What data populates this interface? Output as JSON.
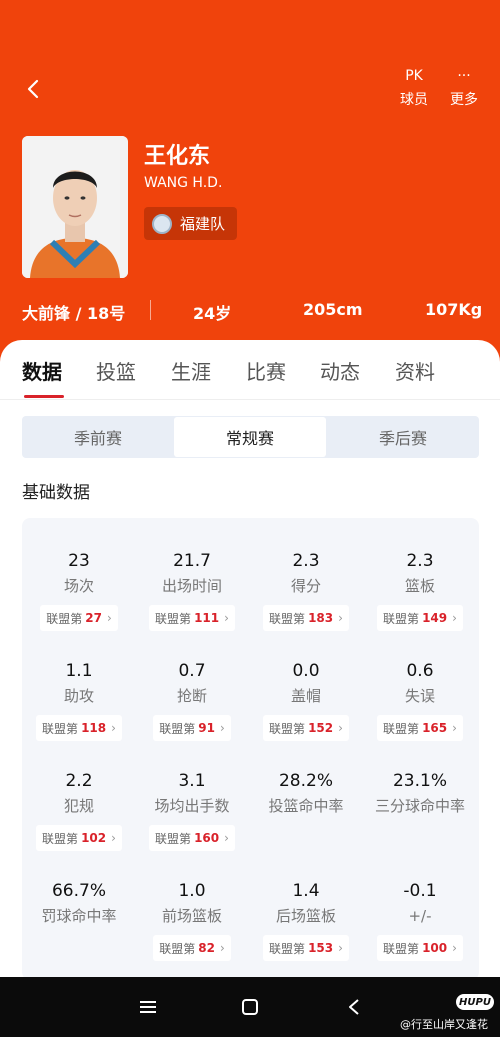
{
  "colors": {
    "brand": "#f0430c",
    "accent_red": "#d9222a",
    "segment_bg": "#e9eef6",
    "card_bg": "#f4f6fa"
  },
  "header": {
    "back_icon": "chevron-left-icon",
    "actions": [
      {
        "icon": "pk-icon",
        "icon_text": "PK",
        "label": "球员"
      },
      {
        "icon": "ellipsis-icon",
        "icon_text": "···",
        "label": "更多"
      }
    ]
  },
  "player": {
    "name": "王化东",
    "en_name": "WANG H.D.",
    "team": "福建队",
    "position_number": "大前锋 / 18号",
    "age": "24岁",
    "height": "205cm",
    "weight": "107Kg"
  },
  "tabs": [
    "数据",
    "投篮",
    "生涯",
    "比赛",
    "动态",
    "资料"
  ],
  "active_tab": "数据",
  "season_segments": [
    "季前赛",
    "常规赛",
    "季后赛"
  ],
  "active_segment": "常规赛",
  "section_title": "基础数据",
  "rank_prefix": "联盟第",
  "stats": [
    {
      "value": "23",
      "label": "场次",
      "rank": "27"
    },
    {
      "value": "21.7",
      "label": "出场时间",
      "rank": "111"
    },
    {
      "value": "2.3",
      "label": "得分",
      "rank": "183"
    },
    {
      "value": "2.3",
      "label": "篮板",
      "rank": "149"
    },
    {
      "value": "1.1",
      "label": "助攻",
      "rank": "118"
    },
    {
      "value": "0.7",
      "label": "抢断",
      "rank": "91"
    },
    {
      "value": "0.0",
      "label": "盖帽",
      "rank": "152"
    },
    {
      "value": "0.6",
      "label": "失误",
      "rank": "165"
    },
    {
      "value": "2.2",
      "label": "犯规",
      "rank": "102"
    },
    {
      "value": "3.1",
      "label": "场均出手数",
      "rank": "160"
    },
    {
      "value": "28.2%",
      "label": "投篮命中率",
      "rank": ""
    },
    {
      "value": "23.1%",
      "label": "三分球命中率",
      "rank": ""
    },
    {
      "value": "66.7%",
      "label": "罚球命中率",
      "rank": ""
    },
    {
      "value": "1.0",
      "label": "前场篮板",
      "rank": "82"
    },
    {
      "value": "1.4",
      "label": "后场篮板",
      "rank": "153"
    },
    {
      "value": "-0.1",
      "label": "+/-",
      "rank": "100"
    }
  ],
  "system_nav": {
    "menu_icon": "menu-icon",
    "home_icon": "home-square-icon",
    "back_icon": "back-triangle-icon"
  },
  "watermark": {
    "logo": "HUPU",
    "text": "@行至山岸又逢花"
  }
}
